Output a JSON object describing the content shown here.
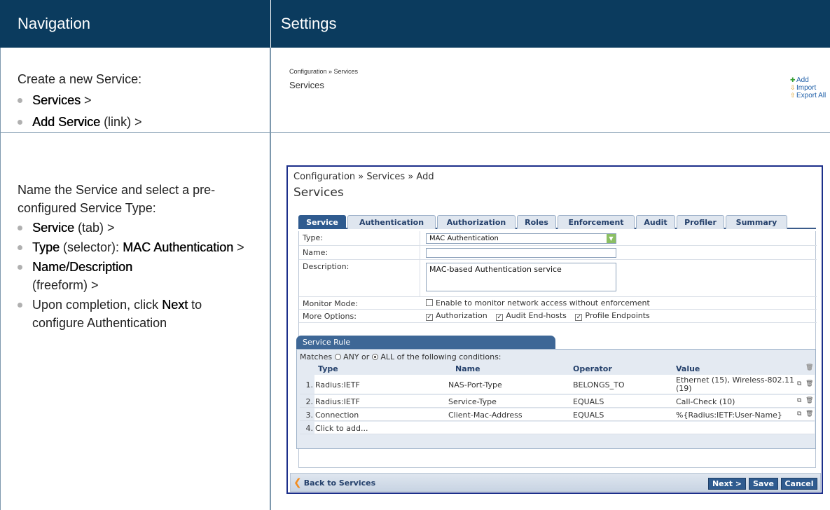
{
  "headers": {
    "navigation": "Navigation",
    "settings": "Settings"
  },
  "row1": {
    "intro": "Create a new Service:",
    "steps": [
      {
        "bold": "Services",
        "rest": " >"
      },
      {
        "bold": "Add Service",
        "rest": " (link) >"
      }
    ],
    "mini": {
      "breadcrumb": "Configuration » Services",
      "title": "Services",
      "actions": [
        {
          "label": "Add",
          "icon": "plus-icon"
        },
        {
          "label": "Import",
          "icon": "import-icon"
        },
        {
          "label": "Export All",
          "icon": "export-icon"
        }
      ]
    }
  },
  "row2": {
    "intro": "Name the Service and select a pre-configured Service Type:",
    "steps": [
      {
        "bold": "Service",
        "rest": " (tab) >"
      },
      {
        "bold": "",
        "pre": "",
        "rest": ""
      },
      {
        "bold": "Name/Description",
        "rest": " (freeform) >"
      },
      {
        "pre": "Upon completion, click ",
        "bold": "Next",
        "rest": " to configure Authentication"
      }
    ],
    "step_type_pre": "Type",
    "step_type_mid": " (selector): ",
    "step_type_val": "MAC Authentication",
    "step_type_rest": " >"
  },
  "screen": {
    "breadcrumb": "Configuration » Services » Add",
    "title": "Services",
    "tabs": [
      "Service",
      "Authentication",
      "Authorization",
      "Roles",
      "Enforcement",
      "Audit",
      "Profiler",
      "Summary"
    ],
    "active_tab": "Service",
    "form": {
      "type_label": "Type:",
      "type_value": "MAC Authentication",
      "name_label": "Name:",
      "name_value": "",
      "desc_label": "Description:",
      "desc_value": "MAC-based Authentication service",
      "monitor_label": "Monitor Mode:",
      "monitor_text": "Enable to monitor network access without enforcement",
      "monitor_checked": false,
      "more_label": "More Options:",
      "options": [
        {
          "label": "Authorization",
          "checked": true
        },
        {
          "label": "Audit End-hosts",
          "checked": true
        },
        {
          "label": "Profile Endpoints",
          "checked": true
        }
      ]
    },
    "rule": {
      "tab_label": "Service Rule",
      "matches_pre": "Matches",
      "any": "ANY",
      "or": "or",
      "all": "ALL",
      "matches_post": "of the following conditions:",
      "selected": "ALL",
      "columns": [
        "Type",
        "Name",
        "Operator",
        "Value"
      ],
      "rows": [
        {
          "num": "1.",
          "type": "Radius:IETF",
          "name": "NAS-Port-Type",
          "operator": "BELONGS_TO",
          "value": "Ethernet (15), Wireless-802.11 (19)"
        },
        {
          "num": "2.",
          "type": "Radius:IETF",
          "name": "Service-Type",
          "operator": "EQUALS",
          "value": "Call-Check (10)"
        },
        {
          "num": "3.",
          "type": "Connection",
          "name": "Client-Mac-Address",
          "operator": "EQUALS",
          "value": "%{Radius:IETF:User-Name}"
        }
      ],
      "add_row": {
        "num": "4.",
        "text": "Click to add..."
      }
    },
    "footer": {
      "back": "Back to Services",
      "buttons": [
        "Next >",
        "Save",
        "Cancel"
      ]
    }
  }
}
